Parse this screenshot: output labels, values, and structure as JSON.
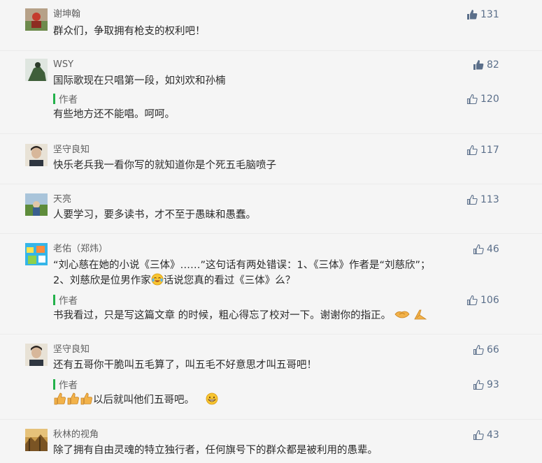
{
  "comments": [
    {
      "user": "谢坤翰",
      "likes": "131",
      "text": "群众们，争取拥有枪支的权利吧！"
    },
    {
      "user": "WSY",
      "likes": "82",
      "text": "国际歌现在只唱第一段，如刘欢和孙楠",
      "reply": {
        "label": "作者",
        "likes": "120",
        "text": "有些地方还不能唱。呵呵。"
      }
    },
    {
      "user": "坚守良知",
      "likes": "117",
      "text": "快乐老兵我一看你写的就知道你是个死五毛脑喷子"
    },
    {
      "user": "天亮",
      "likes": "113",
      "text": "人要学习，要多读书，才不至于愚昧和愚蠢。"
    },
    {
      "user": "老佑（郑炜）",
      "likes": "46",
      "text_line1": "“刘心慈在她的小说《三体》……”这句话有两处错误：1、《三体》作者是“刘慈欣”；",
      "text_line2_a": "2、刘慈欣是位男作家",
      "text_line2_b": "话说您真的看过《三体》么？",
      "reply": {
        "label": "作者",
        "likes": "106",
        "text": "书我看过，只是写这篇文章 的时候，粗心得忘了校对一下。谢谢你的指正。"
      }
    },
    {
      "user": "坚守良知",
      "likes": "66",
      "text": "还有五哥你干脆叫五毛算了，叫五毛不好意思才叫五哥吧！",
      "reply": {
        "label": "作者",
        "likes": "93",
        "text": "以后就叫他们五哥吧。"
      }
    },
    {
      "user": "秋林的视角",
      "likes": "43",
      "text": "除了拥有自由灵魂的特立独行者，任何旗号下的群众都是被利用的愚辈。"
    }
  ],
  "icons": {
    "like_filled": "thumbs-up-filled-icon",
    "like_outline": "thumbs-up-outline-icon"
  },
  "colors": {
    "like": "#5b6f8a",
    "author_bar": "#23b14b",
    "background": "#f5f5f5"
  }
}
